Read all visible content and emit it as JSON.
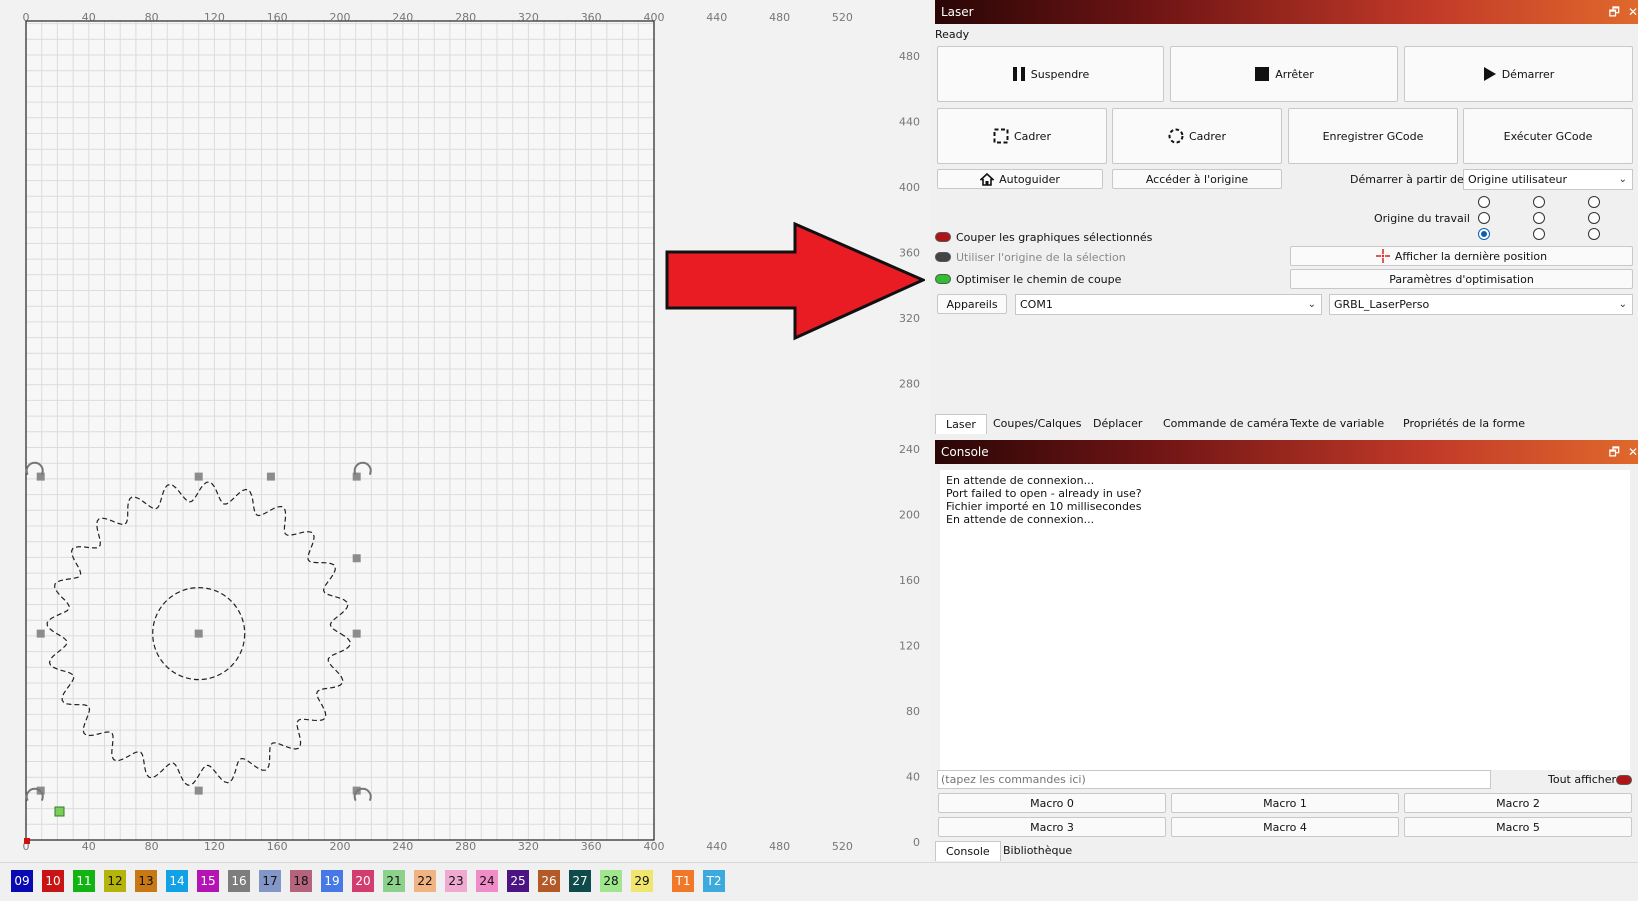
{
  "canvas": {
    "x_ticks": [
      "0",
      "40",
      "80",
      "120",
      "160",
      "200",
      "240",
      "280",
      "320",
      "360",
      "400",
      "440",
      "480",
      "520"
    ],
    "y_ticks": [
      "480",
      "440",
      "400",
      "360",
      "320",
      "280",
      "240",
      "200",
      "160",
      "120",
      "80",
      "40",
      "0"
    ]
  },
  "laser_panel": {
    "title": "Laser",
    "status": "Ready",
    "suspend_label": "Suspendre",
    "stop_label": "Arrêter",
    "start_label": "Démarrer",
    "frame_label": "Cadrer",
    "frame2_label": "Cadrer",
    "save_gcode_label": "Enregistrer GCode",
    "run_gcode_label": "Exécuter GCode",
    "home_label": "Autoguider",
    "goto_origin_label": "Accéder à l'origine",
    "start_from_label": "Démarrer à partir de :",
    "start_from_value": "Origine utilisateur",
    "job_origin_label": "Origine du travail",
    "cut_selected_label": "Couper les graphiques sélectionnés",
    "use_selection_origin_label": "Utiliser l'origine de la sélection",
    "optimize_path_label": "Optimiser le chemin de coupe",
    "show_last_position_label": "Afficher la dernière position",
    "optimization_settings_label": "Paramètres d'optimisation",
    "devices_label": "Appareils",
    "port_value": "COM1",
    "device_value": "GRBL_LaserPerso",
    "toggle_colors": {
      "cut_selected": "#b01515",
      "use_origin": "#333333",
      "optimize": "#2fbf2f"
    }
  },
  "panel_tabs": [
    "Laser",
    "Coupes/Calques",
    "Déplacer",
    "Commande de caméra",
    "Texte de variable",
    "Propriétés de la forme"
  ],
  "console": {
    "title": "Console",
    "lines": [
      "En attende de connexion...",
      "Port failed to open - already in use?",
      "Fichier importé en 10 millisecondes",
      "En attende de connexion..."
    ],
    "input_placeholder": "(tapez les commandes ici)",
    "show_all_label": "Tout afficher",
    "macros": [
      "Macro 0",
      "Macro 1",
      "Macro 2",
      "Macro 3",
      "Macro 4",
      "Macro 5"
    ],
    "bottom_tabs": [
      "Console",
      "Bibliothèque"
    ]
  },
  "palette": [
    {
      "label": "09",
      "color": "#0a0ab4",
      "text": "#ffffff"
    },
    {
      "label": "10",
      "color": "#c81414",
      "text": "#ffffff"
    },
    {
      "label": "11",
      "color": "#12b412",
      "text": "#ffffff"
    },
    {
      "label": "12",
      "color": "#b4b40a",
      "text": "#111111"
    },
    {
      "label": "13",
      "color": "#c87814",
      "text": "#111111"
    },
    {
      "label": "14",
      "color": "#12a0e6",
      "text": "#ffffff"
    },
    {
      "label": "15",
      "color": "#b414b4",
      "text": "#ffffff"
    },
    {
      "label": "16",
      "color": "#7d7d7d",
      "text": "#ffffff"
    },
    {
      "label": "17",
      "color": "#8296c8",
      "text": "#111111"
    },
    {
      "label": "18",
      "color": "#b4647d",
      "text": "#111111"
    },
    {
      "label": "19",
      "color": "#4678e6",
      "text": "#ffffff"
    },
    {
      "label": "20",
      "color": "#d23c6e",
      "text": "#ffffff"
    },
    {
      "label": "21",
      "color": "#8cd28c",
      "text": "#111111"
    },
    {
      "label": "22",
      "color": "#f0b482",
      "text": "#111111"
    },
    {
      "label": "23",
      "color": "#f0aad2",
      "text": "#111111"
    },
    {
      "label": "24",
      "color": "#f08cc8",
      "text": "#111111"
    },
    {
      "label": "25",
      "color": "#4b1482",
      "text": "#ffffff"
    },
    {
      "label": "26",
      "color": "#b45a28",
      "text": "#ffffff"
    },
    {
      "label": "27",
      "color": "#0f4b4b",
      "text": "#ffffff"
    },
    {
      "label": "28",
      "color": "#a0e68c",
      "text": "#111111"
    },
    {
      "label": "29",
      "color": "#f0e66e",
      "text": "#111111"
    },
    {
      "label": "T1",
      "color": "#f07828",
      "text": "#ffffff"
    },
    {
      "label": "T2",
      "color": "#3caadc",
      "text": "#ffffff"
    }
  ]
}
